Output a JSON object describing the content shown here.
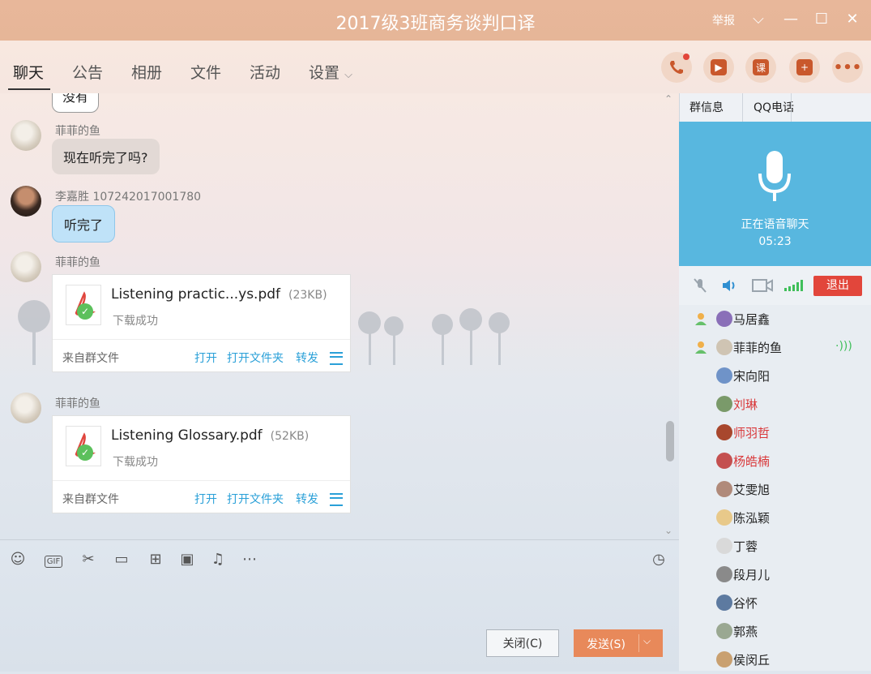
{
  "window": {
    "title": "2017级3班商务谈判口译",
    "report_label": "举报"
  },
  "tabs": [
    "聊天",
    "公告",
    "相册",
    "文件",
    "活动",
    "设置"
  ],
  "toolbar_icons": [
    "phone-icon",
    "video-icon",
    "course-icon",
    "add-message-icon",
    "more-icon"
  ],
  "toolbar_labels": {
    "course": "课"
  },
  "messages": [
    {
      "sender": "",
      "text": "没有"
    },
    {
      "sender": "菲菲的鱼",
      "text": "现在听完了吗?"
    },
    {
      "sender": "李嘉胜 107242017001780",
      "text": "听完了"
    },
    {
      "sender": "菲菲的鱼",
      "file": {
        "name": "Listening practic...ys.pdf",
        "size": "(23KB)",
        "status": "下载成功",
        "source": "来自群文件"
      }
    },
    {
      "sender": "菲菲的鱼",
      "file": {
        "name": "Listening Glossary.pdf",
        "size": "(52KB)",
        "status": "下载成功",
        "source": "来自群文件"
      }
    }
  ],
  "file_actions": {
    "open": "打开",
    "open_folder": "打开文件夹",
    "forward": "转发"
  },
  "input": {
    "close_label": "关闭(C)",
    "send_label": "发送(S)"
  },
  "right_panel": {
    "tabs": [
      "群信息",
      "QQ电话"
    ],
    "voice_status": "正在语音聊天",
    "voice_time": "05:23",
    "exit_label": "退出",
    "members": [
      {
        "name": "马居鑫",
        "red": false,
        "admin": true
      },
      {
        "name": "菲菲的鱼",
        "red": false,
        "admin": true,
        "speaking": true
      },
      {
        "name": "宋向阳",
        "red": false
      },
      {
        "name": "刘琳",
        "red": true
      },
      {
        "name": "师羽哲",
        "red": true
      },
      {
        "name": "杨皓楠",
        "red": true
      },
      {
        "name": "艾雯旭",
        "red": false
      },
      {
        "name": "陈泓颖",
        "red": false
      },
      {
        "name": "丁蓉",
        "red": false
      },
      {
        "name": "段月儿",
        "red": false
      },
      {
        "name": "谷怀",
        "red": false
      },
      {
        "name": "郭燕",
        "red": false
      },
      {
        "name": "侯闵丘",
        "red": false
      }
    ]
  },
  "colors": {
    "accent": "#e8895a",
    "title_bar": "#e6b698",
    "voice_panel": "#58b7df",
    "link": "#2aa0d8",
    "exit": "#e2463b"
  }
}
